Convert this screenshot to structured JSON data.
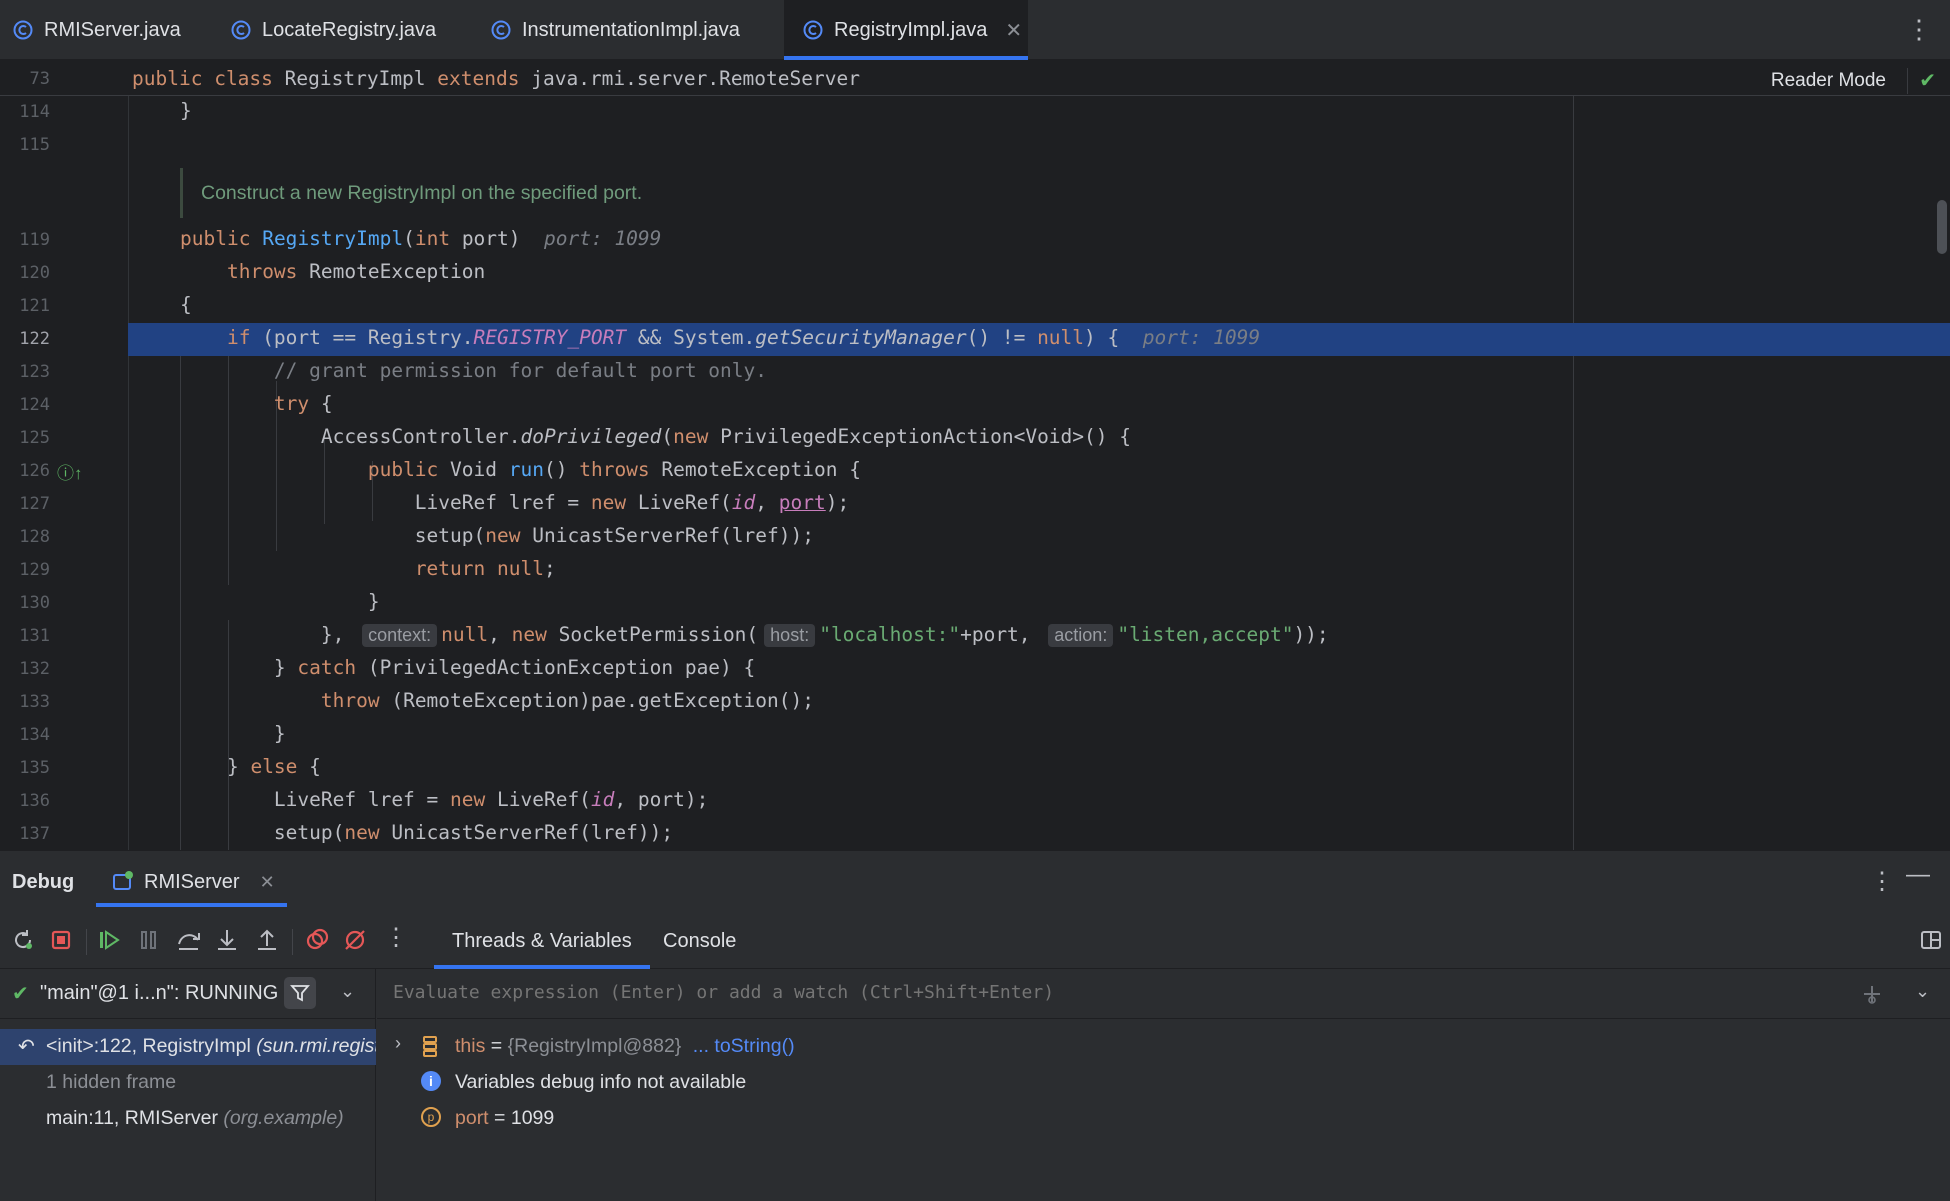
{
  "tabs": [
    {
      "label": "RMIServer.java",
      "active": false
    },
    {
      "label": "LocateRegistry.java",
      "active": false
    },
    {
      "label": "InstrumentationImpl.java",
      "active": false
    },
    {
      "label": "RegistryImpl.java",
      "active": true
    }
  ],
  "editor": {
    "sticky_line_number": "73",
    "sticky_code": {
      "kw1": "public",
      "kw2": "class",
      "name": "RegistryImpl",
      "kw3": "extends",
      "parent": "java.rmi.server.RemoteServer"
    },
    "reader_mode_label": "Reader Mode",
    "doc_comment": "Construct a new RegistryImpl on the specified port.",
    "line_numbers": [
      "114",
      "115",
      "119",
      "120",
      "121",
      "122",
      "123",
      "124",
      "125",
      "126",
      "127",
      "128",
      "129",
      "130",
      "131",
      "132",
      "133",
      "134",
      "135",
      "136",
      "137"
    ],
    "current_line": "122",
    "hints": {
      "ctor_port": "port: 1099",
      "if_port": "port: 1099",
      "context": "context:",
      "host": "host:",
      "action": "action:"
    },
    "comment_text": "// grant permission for default port only."
  },
  "debug": {
    "title": "Debug",
    "session_tab": "RMIServer",
    "subtabs": [
      "Threads & Variables",
      "Console"
    ],
    "thread_label": "\"main\"@1 i...n\": RUNNING",
    "frames": [
      {
        "method": "<init>:122, RegistryImpl",
        "pkg": "(sun.rmi.registry)"
      },
      {
        "method": "1 hidden frame",
        "pkg": ""
      },
      {
        "method": "main:11, RMIServer",
        "pkg": "(org.example)"
      }
    ],
    "eval_placeholder": "Evaluate expression (Enter) or add a watch (Ctrl+Shift+Enter)",
    "variables": {
      "this_name": "this",
      "this_eq": " = ",
      "this_value": "{RegistryImpl@882}",
      "this_link": "... toString()",
      "info": "Variables debug info not available",
      "port_name": "port",
      "port_eq": " = ",
      "port_value": "1099"
    }
  },
  "colors": {
    "accent": "#3574f0",
    "selection": "#214283",
    "keyword": "#cf8e6d",
    "string": "#6aab73",
    "field": "#c77dbb",
    "function": "#56a8f5"
  }
}
